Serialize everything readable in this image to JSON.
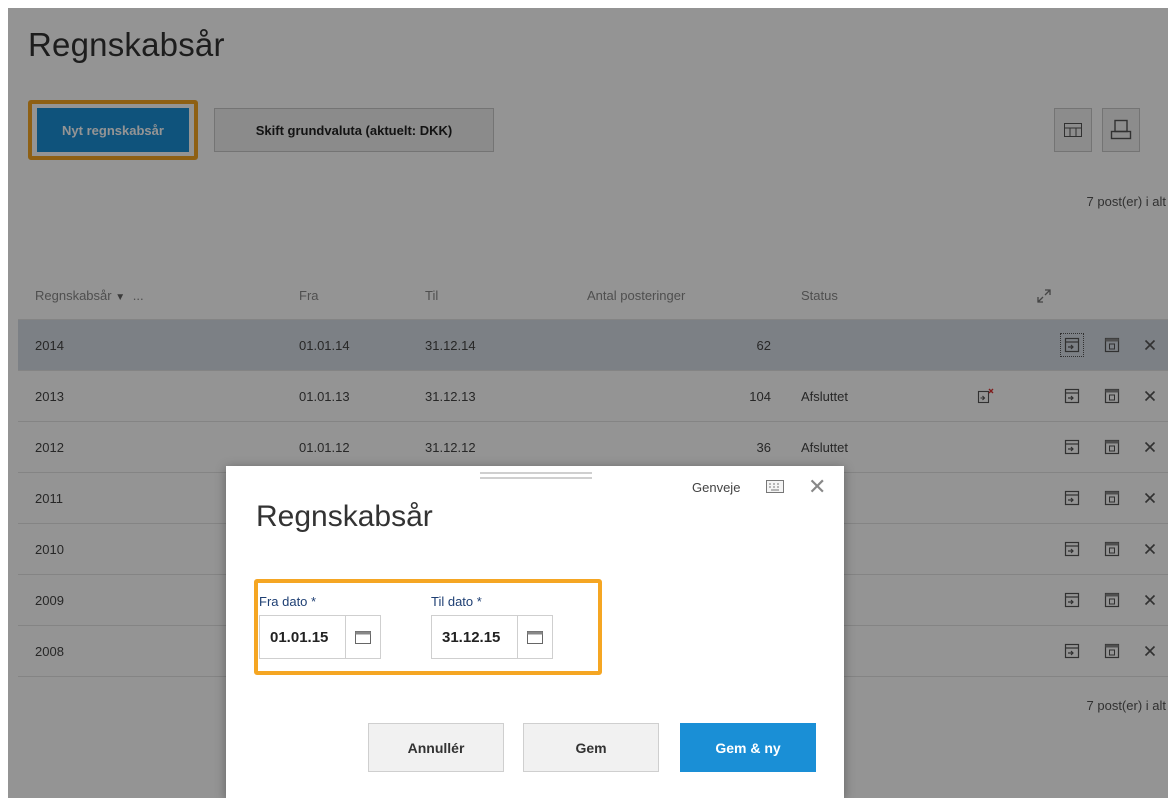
{
  "page": {
    "title": "Regnskabsår",
    "new_button": "Nyt regnskabsår",
    "currency_button": "Skift grundvaluta (aktuelt: DKK)",
    "count_top": "7 post(er) i alt",
    "count_bottom": "7 post(er) i alt",
    "icons": {
      "grid": "grid-view-icon",
      "print": "print-icon",
      "expand": "expand-icon"
    }
  },
  "table": {
    "headers": {
      "year": "Regnskabsår",
      "year_more": "...",
      "fra": "Fra",
      "til": "Til",
      "antal": "Antal posteringer",
      "status": "Status"
    },
    "rows": [
      {
        "year": "2014",
        "fra": "01.01.14",
        "til": "31.12.14",
        "antal": "62",
        "status": ""
      },
      {
        "year": "2013",
        "fra": "01.01.13",
        "til": "31.12.13",
        "antal": "104",
        "status": "Afsluttet"
      },
      {
        "year": "2012",
        "fra": "01.01.12",
        "til": "31.12.12",
        "antal": "36",
        "status": "Afsluttet"
      },
      {
        "year": "2011",
        "fra": "",
        "til": "",
        "antal": "",
        "status": ""
      },
      {
        "year": "2010",
        "fra": "",
        "til": "",
        "antal": "",
        "status": ""
      },
      {
        "year": "2009",
        "fra": "",
        "til": "",
        "antal": "",
        "status": ""
      },
      {
        "year": "2008",
        "fra": "",
        "til": "",
        "antal": "",
        "status": ""
      }
    ],
    "row_icons": [
      "open-period-icon",
      "calendar-icon",
      "delete-icon"
    ]
  },
  "dialog": {
    "title": "Regnskabsår",
    "shortcut_label": "Genveje",
    "fra_label": "Fra dato *",
    "fra_value": "01.01.15",
    "til_label": "Til dato *",
    "til_value": "31.12.15",
    "cancel": "Annullér",
    "save": "Gem",
    "save_new": "Gem & ny"
  },
  "colors": {
    "primary": "#1a8fd6",
    "highlight": "#f5a623",
    "label": "#1e3f73",
    "selected_row": "#d6dde5"
  }
}
